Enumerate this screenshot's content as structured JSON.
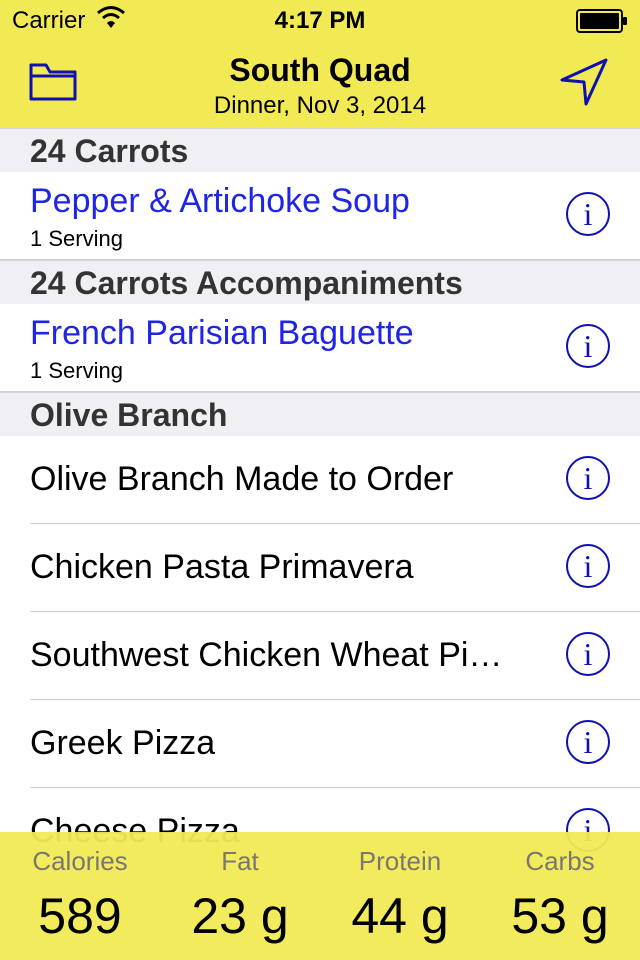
{
  "status_bar": {
    "carrier": "Carrier",
    "time": "4:17 PM"
  },
  "nav": {
    "title": "South Quad",
    "subtitle": "Dinner, Nov 3, 2014",
    "left_icon": "folder-icon",
    "right_icon": "location-arrow-icon"
  },
  "sections": [
    {
      "header": "24 Carrots",
      "items": [
        {
          "title": "Pepper & Artichoke Soup",
          "detail": "1 Serving"
        }
      ]
    },
    {
      "header": "24 Carrots Accompaniments",
      "items": [
        {
          "title": "French Parisian Baguette",
          "detail": "1 Serving"
        }
      ]
    },
    {
      "header": "Olive Branch",
      "items": [
        {
          "title": "Olive Branch Made to Order"
        },
        {
          "title": "Chicken Pasta Primavera"
        },
        {
          "title": "Southwest Chicken Wheat Pi…"
        },
        {
          "title": "Greek Pizza"
        },
        {
          "title": "Cheese Pizza"
        }
      ]
    }
  ],
  "info_glyph": "i",
  "nutrition": {
    "calories_label": "Calories",
    "calories_value": "589",
    "fat_label": "Fat",
    "fat_value": "23 g",
    "protein_label": "Protein",
    "protein_value": "44 g",
    "carbs_label": "Carbs",
    "carbs_value": "53 g"
  },
  "colors": {
    "bar_yellow": "#f2ea55",
    "link_blue": "#1f25e6",
    "info_blue": "#1010b0"
  }
}
